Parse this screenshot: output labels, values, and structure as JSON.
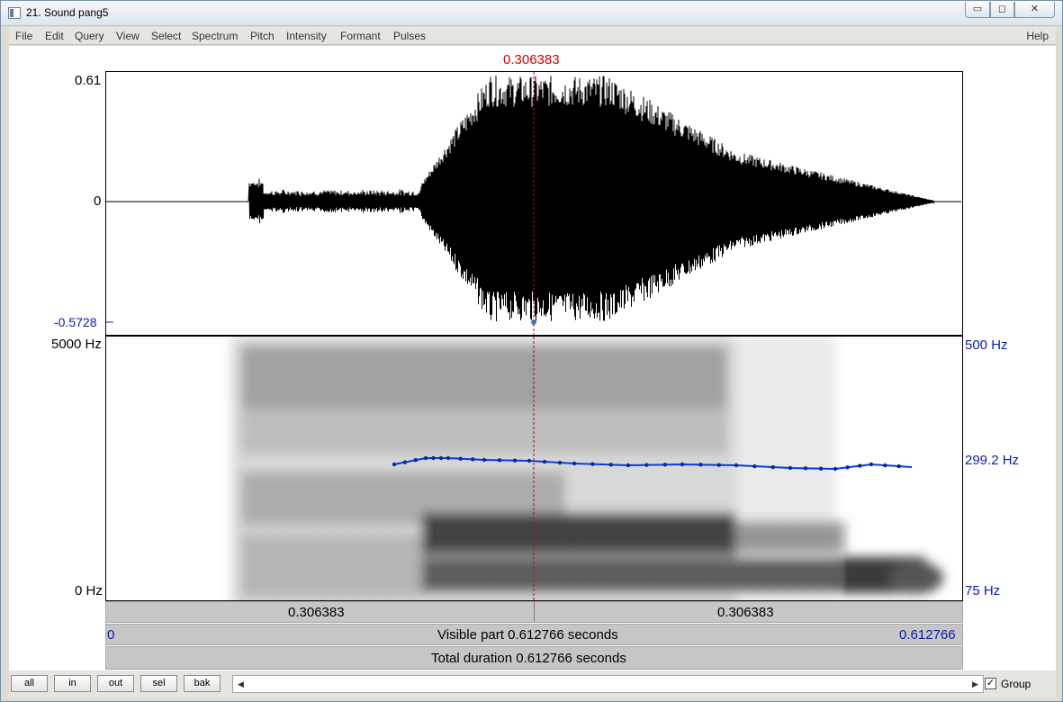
{
  "window": {
    "title": "21. Sound pang5",
    "min_glyph": "▭",
    "max_glyph": "◻",
    "close_glyph": "✕"
  },
  "menu": {
    "items": [
      "File",
      "Edit",
      "Query",
      "View",
      "Select",
      "Spectrum",
      "Pitch",
      "Intensity",
      "Formant",
      "Pulses"
    ],
    "help": "Help"
  },
  "cursor": {
    "time_label": "0.306383"
  },
  "waveform": {
    "ymax_label": "0.61",
    "zero_label": "0",
    "ymin_label": "-0.5728"
  },
  "spectrogram": {
    "top_label": "5000 Hz",
    "bottom_label": "0 Hz"
  },
  "pitch": {
    "top_label": "500 Hz",
    "value_label": "299.2 Hz",
    "bottom_label": "75 Hz",
    "color": "#0a3bd6"
  },
  "strips": {
    "left_time": "0.306383",
    "right_time": "0.306383",
    "visible_start": "0",
    "visible_text": "Visible part 0.612766 seconds",
    "visible_end": "0.612766",
    "total_text": "Total duration 0.612766 seconds"
  },
  "bottom": {
    "buttons": [
      "all",
      "in",
      "out",
      "sel",
      "bak"
    ],
    "group_label": "Group",
    "group_checked": "✓",
    "left_arrow": "◀",
    "right_arrow": "▶"
  }
}
